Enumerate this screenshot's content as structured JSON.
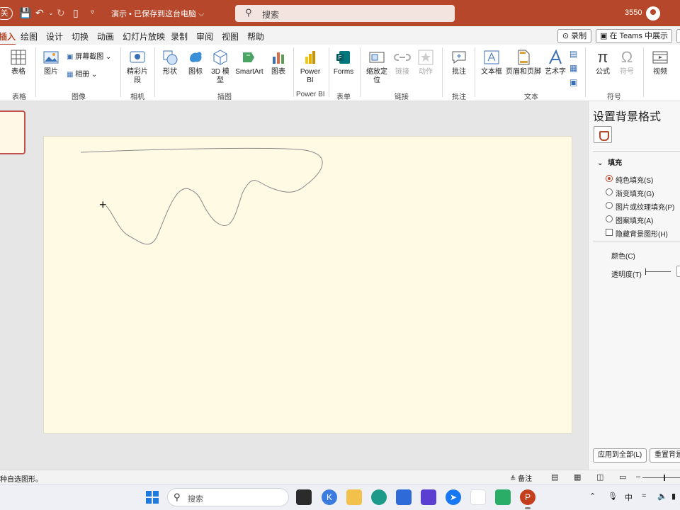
{
  "titlebar": {
    "autosave_label": "关",
    "doc_title": "演示 • 已保存到这台电脑 ⌵",
    "search_placeholder": "搜索",
    "user_id": "3550"
  },
  "tabs": [
    {
      "label": "插入",
      "active": true
    },
    {
      "label": "绘图"
    },
    {
      "label": "设计"
    },
    {
      "label": "切换"
    },
    {
      "label": "动画"
    },
    {
      "label": "幻灯片放映"
    },
    {
      "label": "录制"
    },
    {
      "label": "审阅"
    },
    {
      "label": "视图"
    },
    {
      "label": "帮助"
    }
  ],
  "tab_buttons": {
    "record": "⊙ 录制",
    "teams": "▣ 在 Teams 中展示"
  },
  "ribbon": {
    "items": {
      "table": "表格",
      "picture": "图片",
      "screenshot": "屏幕截图",
      "album": "相册",
      "cameo": "精彩片段",
      "shapes": "形状",
      "icons": "图标",
      "model3d": "3D 模型",
      "smartart": "SmartArt",
      "chart": "图表",
      "powerbi": "Power BI",
      "forms": "Forms",
      "zoom": "缩放定位",
      "link": "链接",
      "action": "动作",
      "comment": "批注",
      "textbox": "文本框",
      "header_footer": "页眉和页脚",
      "wordart": "艺术字",
      "equation": "公式",
      "symbol": "符号",
      "video": "视频"
    },
    "groups": {
      "tables": "表格",
      "images": "图像",
      "camera": "相机",
      "illustrations": "插图",
      "powerbi": "Power BI",
      "forms": "表单",
      "links": "链接",
      "comments": "批注",
      "text": "文本",
      "symbols": "符号"
    }
  },
  "pane": {
    "title": "设置背景格式",
    "section_fill": "填充",
    "fill_options": [
      {
        "label": "纯色填充(S)",
        "selected": true
      },
      {
        "label": "渐变填充(G)",
        "selected": false
      },
      {
        "label": "图片或纹理填充(P)",
        "selected": false
      },
      {
        "label": "图案填充(A)",
        "selected": false
      }
    ],
    "hide_bg_graphics": "隐藏背景图形(H)",
    "color_label": "颜色(C)",
    "transparency_label": "透明度(T)",
    "apply_all": "应用到全部(L)",
    "reset": "重置背景"
  },
  "statusbar": {
    "message": "种自选图形。",
    "notes": "≜ 备注"
  },
  "taskbar": {
    "search_placeholder": "搜索",
    "ime": "中"
  },
  "colors": {
    "accent": "#b7472a",
    "slide_background": "#fefae3"
  }
}
